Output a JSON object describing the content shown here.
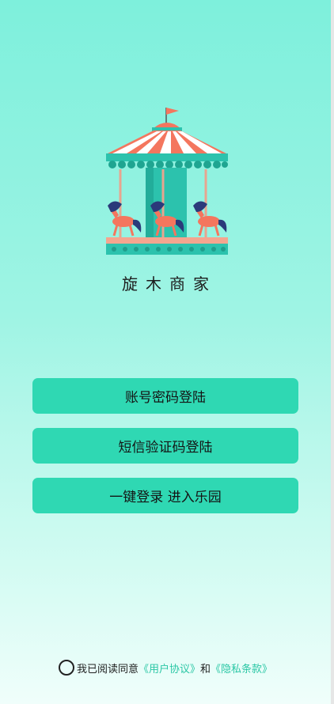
{
  "app": {
    "name": "旋木商家"
  },
  "login": {
    "account_password_label": "账号密码登陆",
    "sms_code_label": "短信验证码登陆",
    "one_key_label": "一键登录 进入乐园"
  },
  "agreement": {
    "prefix": "我已阅读同意",
    "user_agreement": "《用户协议》",
    "conjunction": "和",
    "privacy_policy": "《隐私条款》"
  },
  "colors": {
    "accent": "#2fd8b3",
    "link": "#2bc7a5",
    "carousel_roof_red": "#f4765e",
    "carousel_teal": "#2cc2ad",
    "horse_navy": "#2b3a7a"
  },
  "icons": {
    "logo": "carousel-logo-icon",
    "checkbox": "unchecked-circle-icon"
  }
}
